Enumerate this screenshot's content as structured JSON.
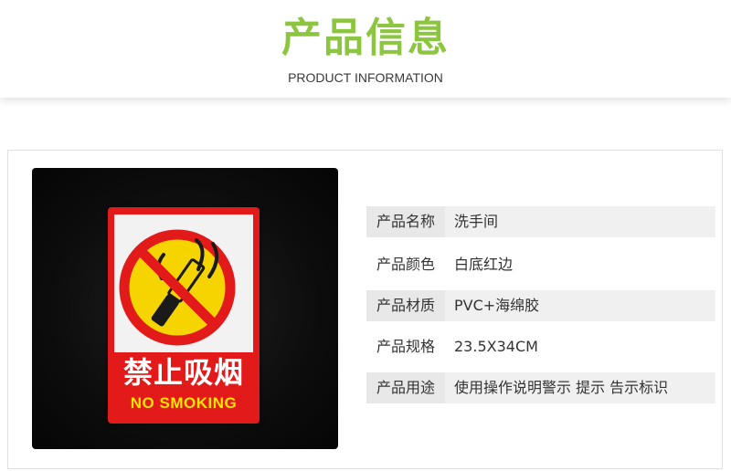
{
  "header": {
    "title": "产品信息",
    "subtitle": "PRODUCT INFORMATION"
  },
  "sign": {
    "chinese_text": "禁止吸烟",
    "english_text": "NO SMOKING"
  },
  "info_rows": [
    {
      "label": "产品名称",
      "value": "洗手间"
    },
    {
      "label": "产品颜色",
      "value": "白底红边"
    },
    {
      "label": "产品材质",
      "value": "PVC+海绵胶"
    },
    {
      "label": "产品规格",
      "value": "23.5X34CM"
    },
    {
      "label": "产品用途",
      "value": "使用操作说明警示 提示 告示标识"
    }
  ],
  "colors": {
    "accent_green": "#8cc63f",
    "sign_red": "#e21a1a",
    "sign_yellow": "#ffe500"
  }
}
